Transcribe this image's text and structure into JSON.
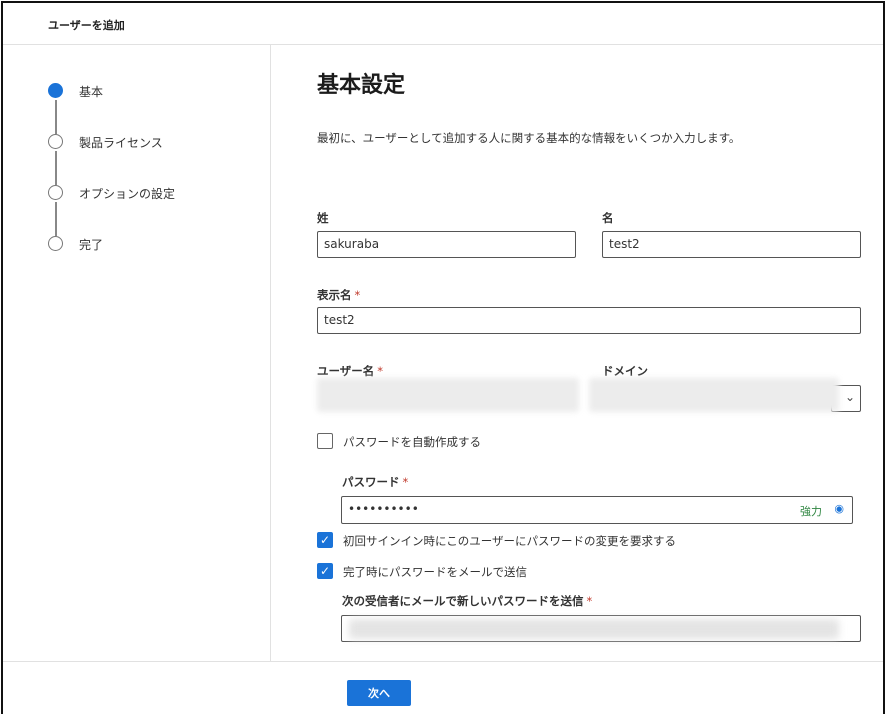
{
  "header": {
    "title": "ユーザーを追加"
  },
  "steps": [
    {
      "label": "基本",
      "active": true
    },
    {
      "label": "製品ライセンス",
      "active": false
    },
    {
      "label": "オプションの設定",
      "active": false
    },
    {
      "label": "完了",
      "active": false
    }
  ],
  "main": {
    "title": "基本設定",
    "description": "最初に、ユーザーとして追加する人に関する基本的な情報をいくつか入力します。"
  },
  "form": {
    "last_name": {
      "label": "姓",
      "value": "sakuraba"
    },
    "first_name": {
      "label": "名",
      "value": "test2"
    },
    "display_name": {
      "label": "表示名",
      "required": "*",
      "value": "test2"
    },
    "username": {
      "label": "ユーザー名",
      "required": "*"
    },
    "domain": {
      "label": "ドメイン"
    },
    "auto_password": {
      "label": "パスワードを自動作成する",
      "checked": false
    },
    "password": {
      "label": "パスワード",
      "required": "*",
      "value": "••••••••••",
      "strength": "強力"
    },
    "require_change": {
      "label": "初回サインイン時にこのユーザーにパスワードの変更を要求する",
      "checked": true
    },
    "email_password": {
      "label": "完了時にパスワードをメールで送信",
      "checked": true
    },
    "recipients": {
      "label": "次の受信者にメールで新しいパスワードを送信",
      "required": "*"
    }
  },
  "footer": {
    "next_label": "次へ"
  },
  "colors": {
    "accent": "#1a73d8",
    "strength": "#2e8540",
    "required": "#c0392b"
  },
  "icons": {
    "dropdown": "chevron-down-icon",
    "reveal": "eye-icon",
    "check": "checkmark-icon"
  }
}
